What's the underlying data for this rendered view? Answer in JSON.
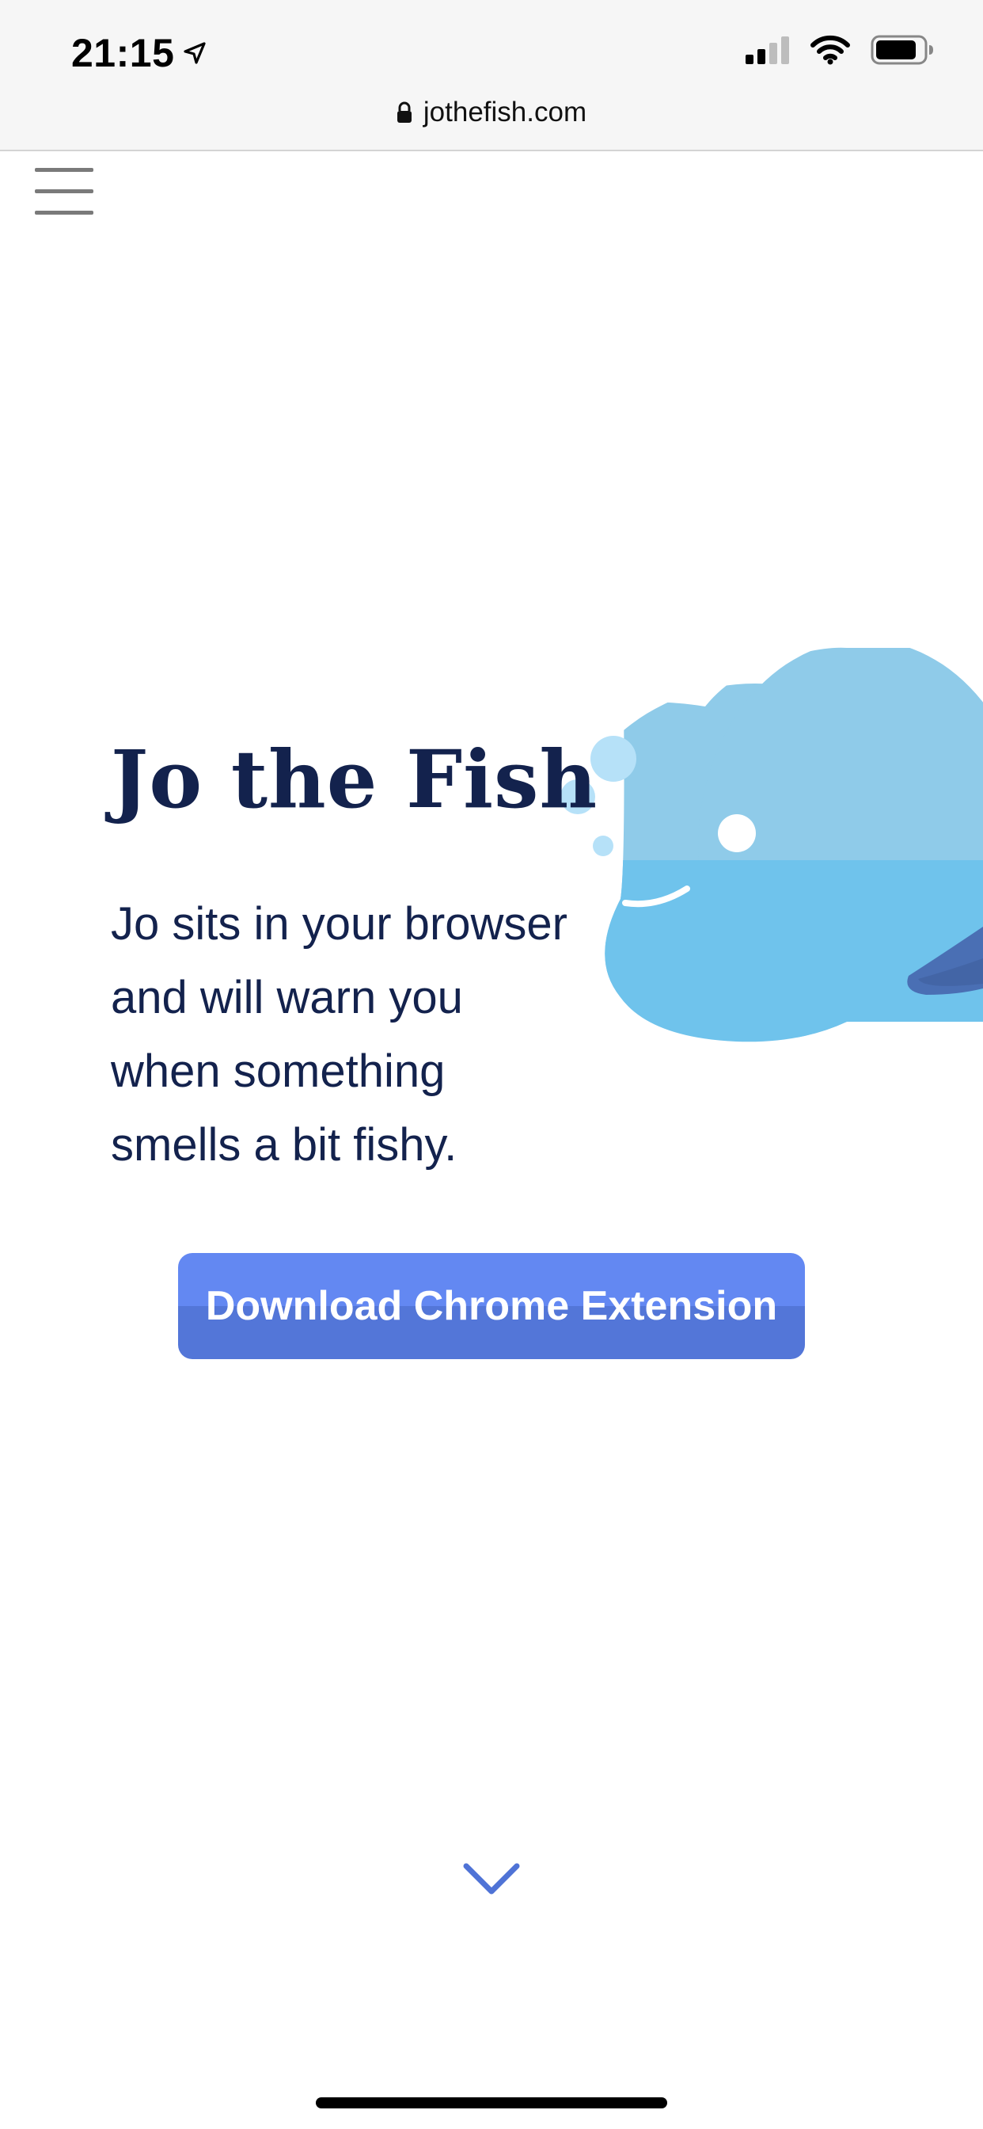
{
  "status_bar": {
    "time": "21:15",
    "icons": [
      "location-arrow-icon",
      "cellular-signal-icon",
      "wifi-icon",
      "battery-icon"
    ]
  },
  "browser": {
    "url": "jothefish.com",
    "lock_icon": "lock-icon"
  },
  "nav": {
    "menu_icon": "hamburger-menu-icon"
  },
  "hero": {
    "title": "Jo the Fish",
    "description_lines": [
      "Jo sits in your browser",
      "and will warn you",
      "when something",
      "smells a bit fishy."
    ],
    "cta_label": "Download Chrome Extension",
    "illustration": "fish-illustration"
  },
  "scroll": {
    "icon": "chevron-down-icon"
  },
  "colors": {
    "title_text": "#13224d",
    "cta_top": "#6388f2",
    "cta_bottom": "#5376d8",
    "fish_light": "#8fcbe9",
    "fish_body": "#6fc3ec",
    "fin": "#4a6fb4",
    "chevron": "#4f73d6"
  }
}
